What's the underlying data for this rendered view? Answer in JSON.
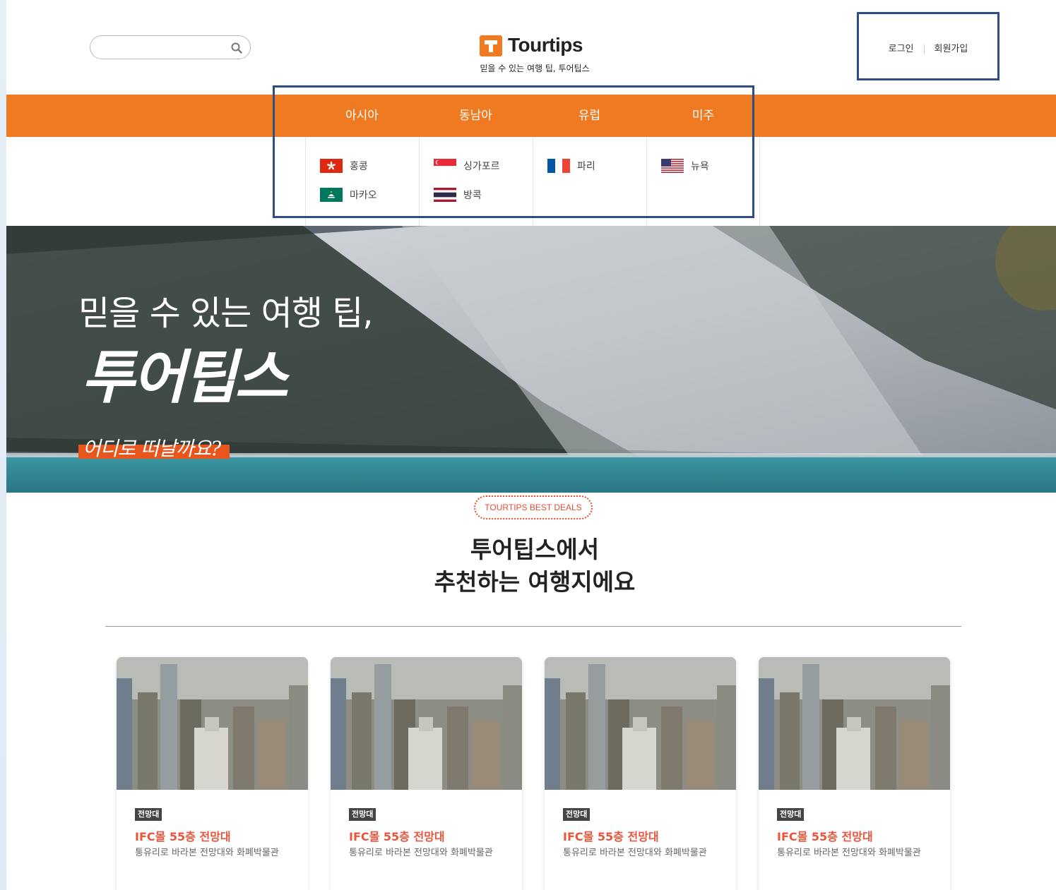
{
  "header": {
    "search_placeholder": "",
    "logo_text": "Tourtips",
    "tagline": "믿을 수 있는 여행 팁, 투어팁스",
    "login": "로그인",
    "signup": "회원가입"
  },
  "nav": {
    "items": [
      {
        "label": "아시아",
        "cities": [
          {
            "name": "홍콩",
            "flag": "hongkong"
          },
          {
            "name": "마카오",
            "flag": "macau"
          }
        ]
      },
      {
        "label": "동남아",
        "cities": [
          {
            "name": "싱가포르",
            "flag": "singapore"
          },
          {
            "name": "방콕",
            "flag": "thailand"
          }
        ]
      },
      {
        "label": "유럽",
        "cities": [
          {
            "name": "파리",
            "flag": "france"
          }
        ]
      },
      {
        "label": "미주",
        "cities": [
          {
            "name": "뉴욕",
            "flag": "usa"
          }
        ]
      }
    ]
  },
  "hero": {
    "line1": "믿을 수 있는 여행 팁,",
    "line2": "투어팁스",
    "cta": "어디로 떠날까요?"
  },
  "deals": {
    "badge": "TOURTIPS BEST DEALS",
    "title_line1": "투어팁스에서",
    "title_line2": "추천하는 여행지에요",
    "cards": [
      {
        "tag": "전망대",
        "title": "IFC몰 55층 전망대",
        "desc": "통유리로 바라본 전망대와 화폐박물관"
      },
      {
        "tag": "전망대",
        "title": "IFC몰 55층 전망대",
        "desc": "통유리로 바라본 전망대와 화폐박물관"
      },
      {
        "tag": "전망대",
        "title": "IFC몰 55층 전망대",
        "desc": "통유리로 바라본 전망대와 화폐박물관"
      },
      {
        "tag": "전망대",
        "title": "IFC몰 55층 전망대",
        "desc": "통유리로 바라본 전망대와 화폐박물관"
      }
    ]
  },
  "colors": {
    "brand_orange": "#f07a22",
    "accent_red": "#e8553a",
    "highlight_blue": "#2d4d86"
  }
}
